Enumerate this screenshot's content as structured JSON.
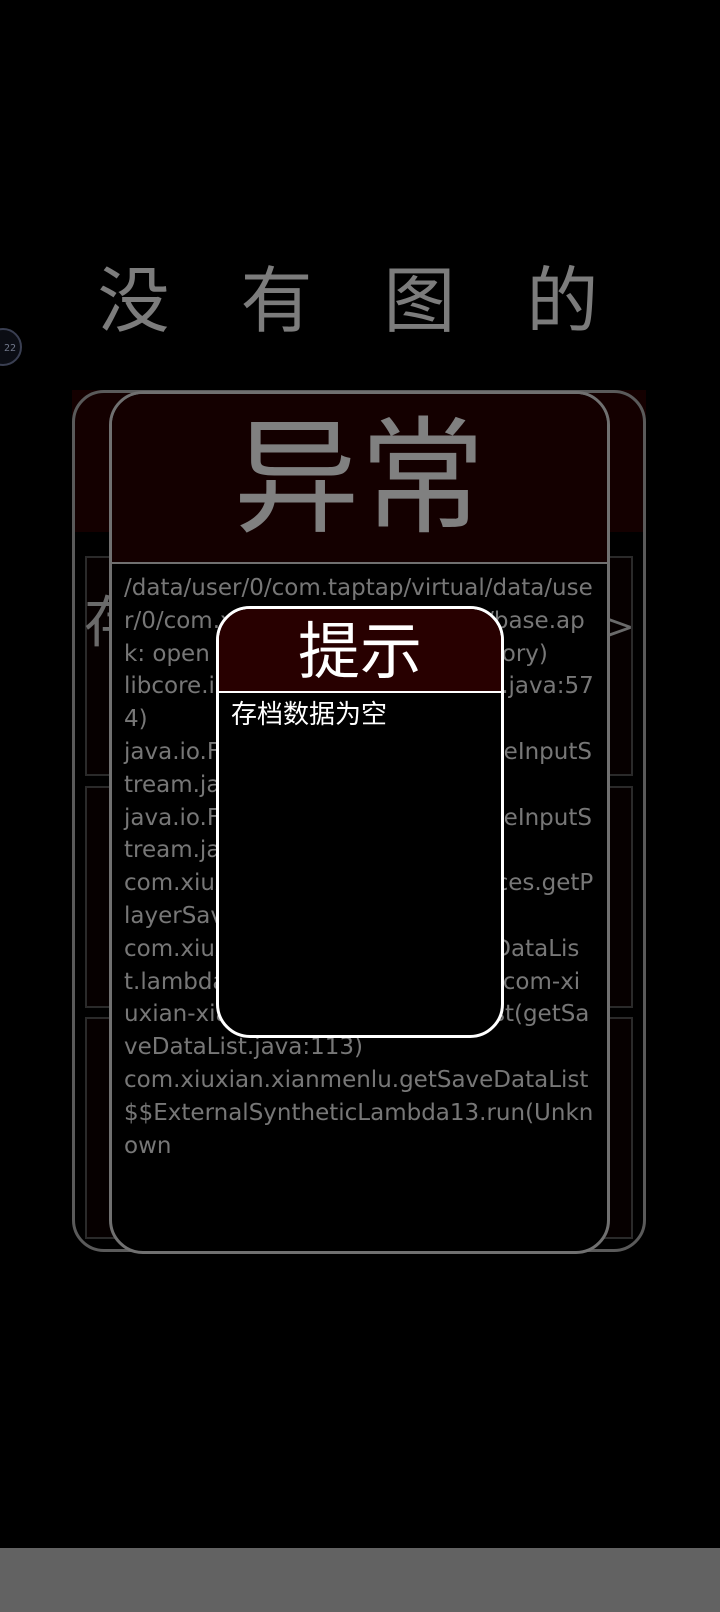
{
  "page": {
    "title": "没 有 图 的",
    "floating_bubble": "22"
  },
  "background_panel": {
    "left_glyph": "存",
    "right_glyph": ">"
  },
  "exception": {
    "title": "异常",
    "stack_trace": "/data/user/0/com.taptap/virtual/data/user/0/com.xiuxian.xianmenlu/files/base.apk: open failed: EISDIR (Is a directory)\nlibcore.io.IoBridge.open(IoBridge.java:574)\njava.io.FileInputStream.<init>(FileInputStream.java:160)\njava.io.FileInputStream.<init>(FileInputStream.java:115)\ncom.xiuxian.xianmenlu.Preferences.getPlayerSave(Preferences.java:56)\ncom.xiuxian.xianmenlu.getSaveDataList.lambda$loadSavewithIndex$6$com-xiuxian-xianmenlu-getSaveDataList(getSaveDataList.java:113)\ncom.xiuxian.xianmenlu.getSaveDataList$$ExternalSyntheticLambda13.run(Unknown"
  },
  "dialog": {
    "title": "提示",
    "message": "存档数据为空"
  }
}
